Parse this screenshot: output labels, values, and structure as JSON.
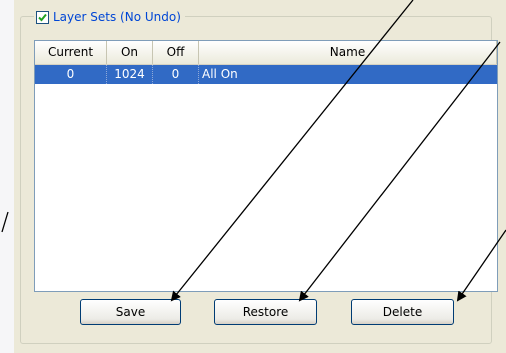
{
  "group": {
    "checkbox_checked": true,
    "title": "Layer Sets (No Undo)"
  },
  "table": {
    "columns": [
      "Current",
      "On",
      "Off",
      "Name"
    ],
    "rows": [
      {
        "current": "0",
        "on": "1024",
        "off": "0",
        "name": "All On",
        "selected": true
      }
    ]
  },
  "buttons": {
    "save": "Save",
    "restore": "Restore",
    "delete": "Delete"
  },
  "colors": {
    "selection": "#316ac5",
    "title_text": "#0046d5",
    "panel": "#ece9d8"
  }
}
